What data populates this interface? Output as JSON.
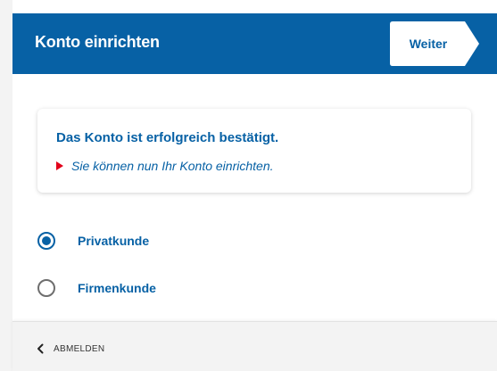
{
  "header": {
    "title": "Konto einrichten",
    "next_label": "Weiter"
  },
  "message": {
    "title": "Das Konto ist erfolgreich bestätigt.",
    "subtitle": "Sie können nun Ihr Konto einrichten."
  },
  "options": [
    {
      "label": "Privatkunde",
      "selected": true
    },
    {
      "label": "Firmenkunde",
      "selected": false
    }
  ],
  "footer": {
    "logout_label": "ABMELDEN"
  },
  "colors": {
    "brand_blue": "#0761a5",
    "accent_red": "#e2001a",
    "background": "#f3f3f3"
  },
  "icons": {
    "next": "chevron-arrow-shape",
    "message": "red-triangle-arrow-icon",
    "logout": "chevron-left-icon"
  }
}
